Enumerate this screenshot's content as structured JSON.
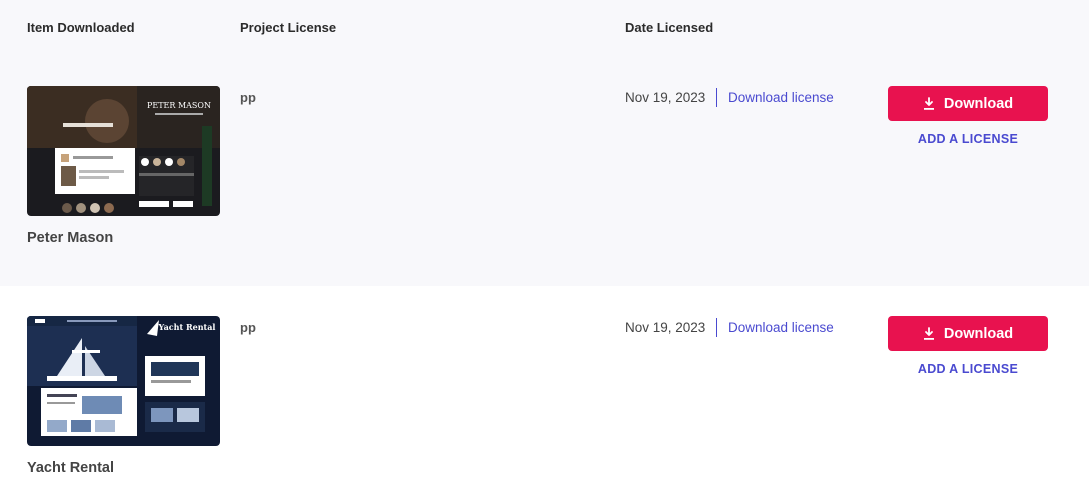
{
  "table": {
    "headers": {
      "item": "Item Downloaded",
      "project": "Project License",
      "date": "Date Licensed"
    },
    "rows": [
      {
        "name": "Peter Mason",
        "thumbnail_text": "PETER MASON",
        "project_license": "pp",
        "date_licensed": "Nov 19, 2023",
        "download_license_label": "Download license",
        "download_label": "Download",
        "add_license_label": "ADD A LICENSE"
      },
      {
        "name": "Yacht Rental",
        "thumbnail_text": "Yacht Rental",
        "project_license": "pp",
        "date_licensed": "Nov 19, 2023",
        "download_license_label": "Download license",
        "download_label": "Download",
        "add_license_label": "ADD A LICENSE"
      }
    ]
  },
  "colors": {
    "accent_button": "#e8124f",
    "link": "#4a4ad0",
    "row_shade": "#f8f8fb"
  },
  "icons": {
    "download_button_icon": "download-icon"
  }
}
